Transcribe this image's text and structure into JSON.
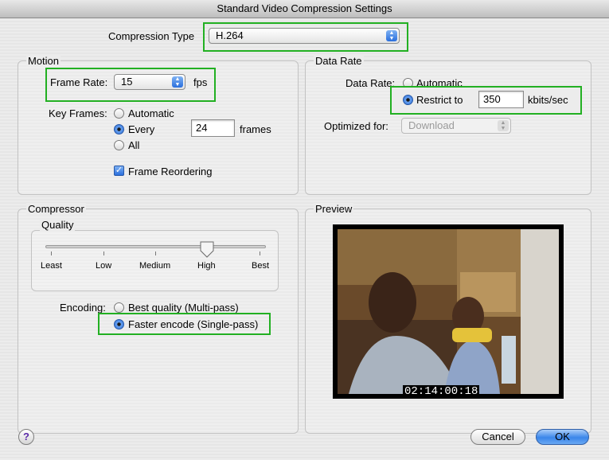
{
  "window": {
    "title": "Standard Video Compression Settings"
  },
  "compression": {
    "label": "Compression Type",
    "value": "H.264"
  },
  "motion": {
    "title": "Motion",
    "frame_rate_label": "Frame Rate:",
    "frame_rate_value": "15",
    "frame_rate_unit": "fps",
    "key_frames_label": "Key Frames:",
    "key_frames_options": [
      "Automatic",
      "Every",
      "All"
    ],
    "key_frames_selected": "Every",
    "key_frames_every_value": "24",
    "key_frames_every_unit": "frames",
    "frame_reordering_label": "Frame Reordering",
    "frame_reordering_checked": true
  },
  "data_rate": {
    "title": "Data Rate",
    "label": "Data Rate:",
    "options": [
      "Automatic",
      "Restrict to"
    ],
    "selected": "Restrict to",
    "restrict_value": "350",
    "restrict_unit": "kbits/sec",
    "optimized_label": "Optimized for:",
    "optimized_value": "Download"
  },
  "compressor": {
    "title": "Compressor",
    "quality_title": "Quality",
    "quality_levels": [
      "Least",
      "Low",
      "Medium",
      "High",
      "Best"
    ],
    "quality_selected": "High",
    "encoding_label": "Encoding:",
    "encoding_options": [
      "Best quality (Multi-pass)",
      "Faster encode (Single-pass)"
    ],
    "encoding_selected": "Faster encode (Single-pass)"
  },
  "preview": {
    "title": "Preview",
    "timecode": "02:14:00:18"
  },
  "buttons": {
    "help": "?",
    "cancel": "Cancel",
    "ok": "OK"
  },
  "colors": {
    "highlight": "#22b022",
    "accent": "#2c6fd9"
  }
}
